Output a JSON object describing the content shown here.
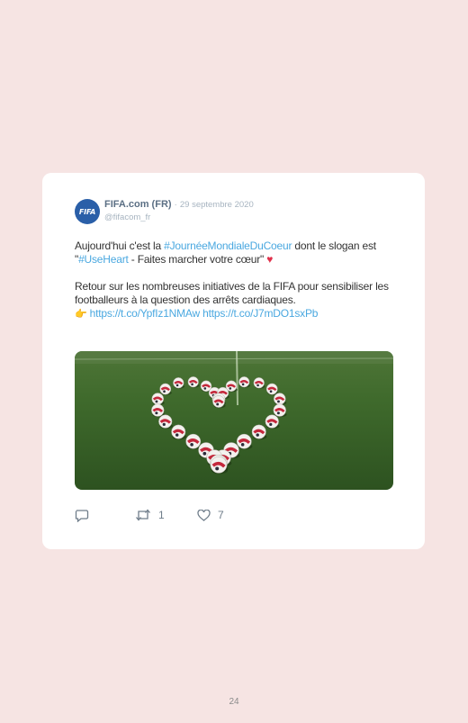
{
  "tweet": {
    "avatar_text": "FIFA",
    "name": "FIFA.com (FR)",
    "separator": "·",
    "date": "29 septembre 2020",
    "handle": "@fifacom_fr",
    "line1_pre": "Aujourd'hui c'est la ",
    "hashtag1": "#JournéeMondialeDuCoeur",
    "line1_mid": " dont le slogan est \"",
    "hashtag2": "#UseHeart",
    "line1_post": " - Faites marcher votre cœur\" ",
    "heart_emoji": "♥",
    "para2": "Retour sur les nombreuses initiatives de la FIFA pour sensibiliser les footballeurs à la question des arrêts cardiaques.",
    "point_emoji": "👉",
    "link1": "https://t.co/YpfIz1NMAw",
    "link2": "https://t.co/J7mDO1sxPb",
    "image_alt": "Ballons de football disposés en forme de cœur sur une pelouse",
    "retweets": "1",
    "likes": "7"
  },
  "footer": {
    "page_number": "24"
  },
  "colors": {
    "page_bg": "#f6e4e3",
    "link": "#4aa8e0",
    "name": "#5b6f84",
    "muted": "#a7b4c0"
  }
}
